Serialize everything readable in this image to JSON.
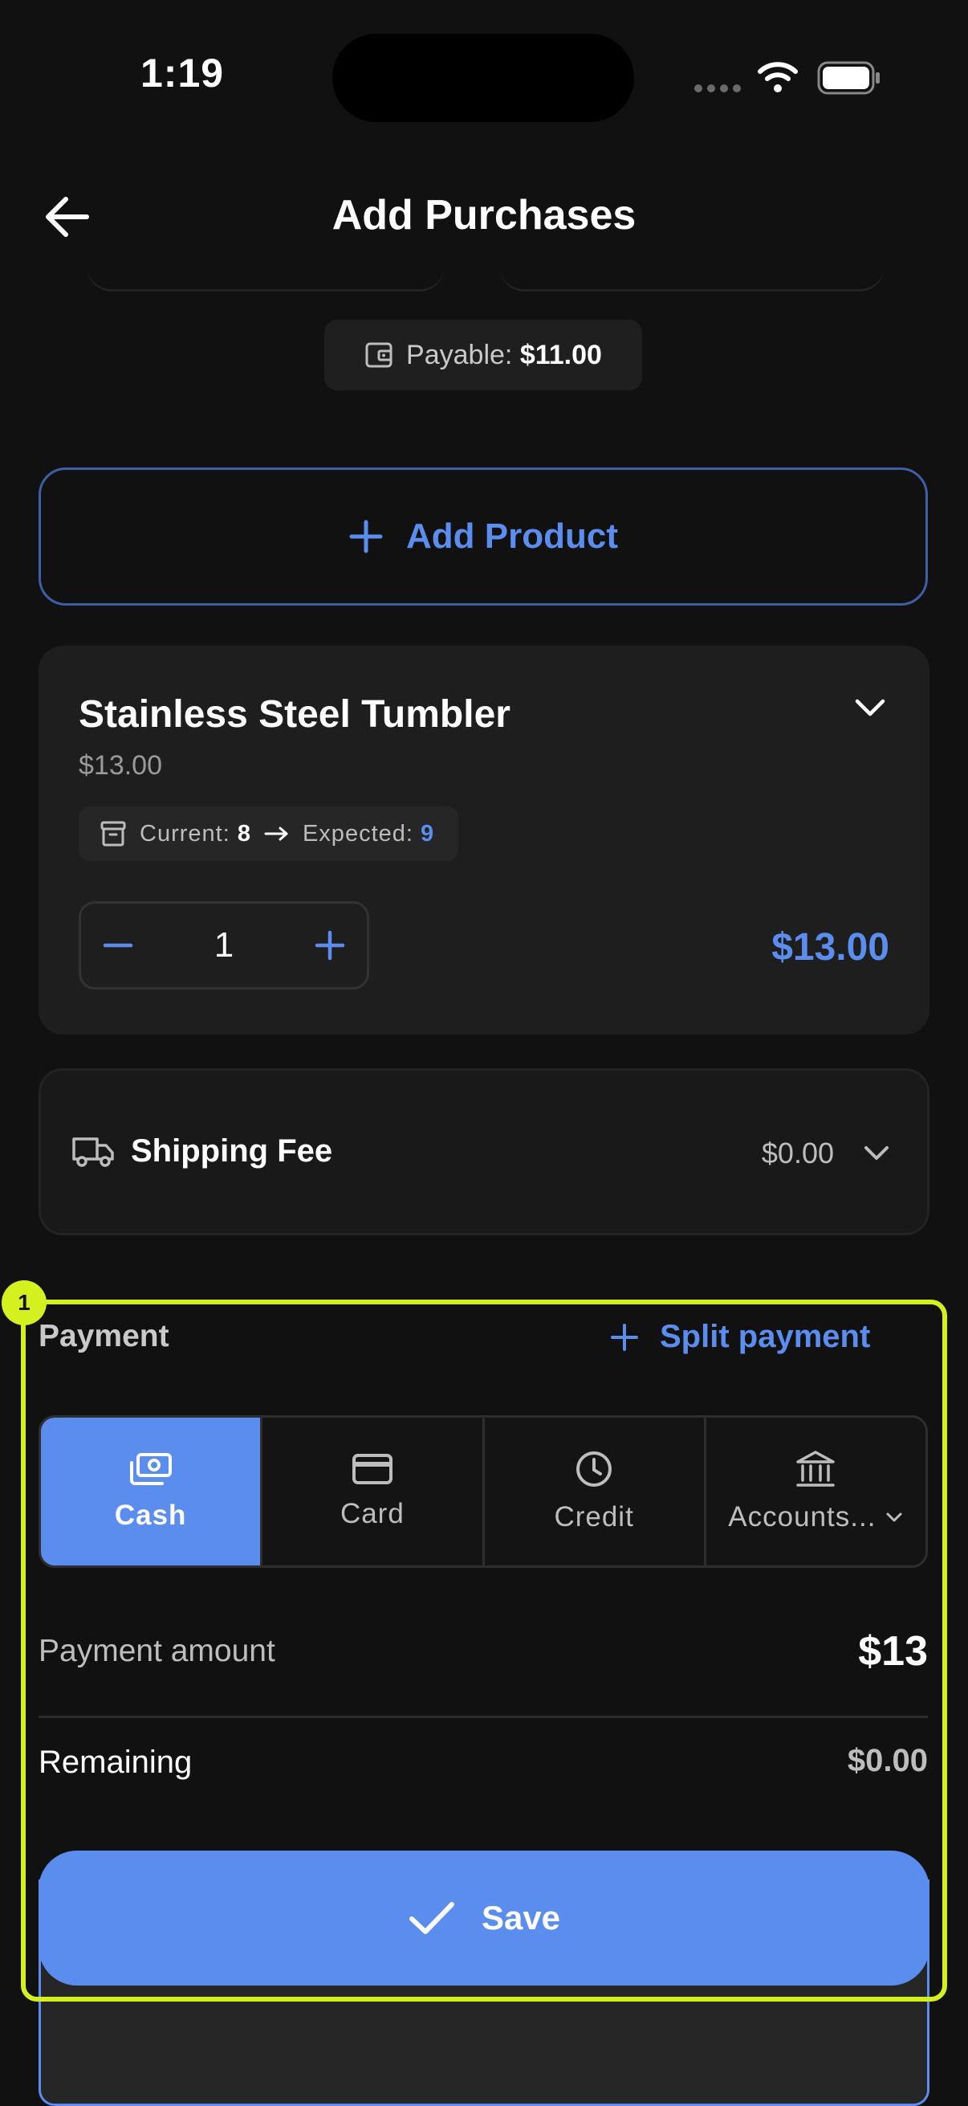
{
  "status_bar": {
    "time": "1:19"
  },
  "header": {
    "title": "Add Purchases"
  },
  "payable": {
    "label": "Payable:",
    "value": "$11.00"
  },
  "add_product": {
    "label": "Add Product"
  },
  "product": {
    "name": "Stainless Steel Tumbler",
    "price": "$13.00",
    "current_label": "Current:",
    "current_value": "8",
    "expected_label": "Expected:",
    "expected_value": "9",
    "quantity": "1",
    "line_total": "$13.00"
  },
  "shipping": {
    "label": "Shipping Fee",
    "value": "$0.00"
  },
  "payment": {
    "title": "Payment",
    "split_label": "Split payment",
    "methods": [
      {
        "label": "Cash",
        "icon": "cash-icon",
        "selected": true
      },
      {
        "label": "Card",
        "icon": "card-icon",
        "selected": false
      },
      {
        "label": "Credit",
        "icon": "clock-icon",
        "selected": false
      },
      {
        "label": "Accounts...",
        "icon": "bank-icon",
        "selected": false
      }
    ],
    "amount_label": "Payment amount",
    "amount_value": "$13",
    "remaining_label": "Remaining",
    "remaining_value": "$0.00"
  },
  "save": {
    "label": "Save"
  },
  "annotation": {
    "badge": "1"
  },
  "colors": {
    "accent": "#5b8def",
    "background": "#111111",
    "highlight": "#d4f01e"
  }
}
